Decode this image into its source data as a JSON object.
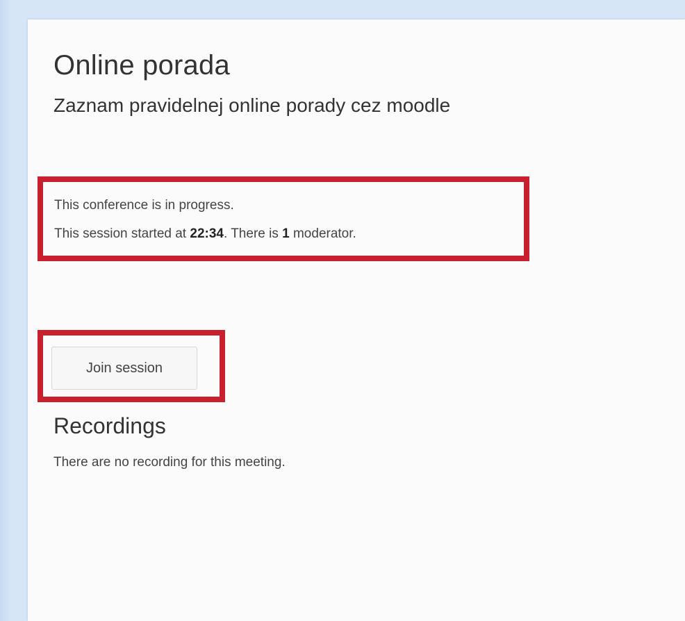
{
  "meeting": {
    "title": "Online porada",
    "description": "Zaznam pravidelnej online porady cez moodle"
  },
  "status": {
    "line1": "This conference is in progress.",
    "line2_prefix": "This session started at ",
    "start_time": "22:34",
    "line2_middle": ". There is ",
    "moderator_count": "1",
    "line2_suffix": " moderator."
  },
  "actions": {
    "join_label": "Join session"
  },
  "recordings": {
    "heading": "Recordings",
    "empty_message": "There are no recording for this meeting."
  },
  "colors": {
    "highlight_border": "#c8202f",
    "page_background": "#d7e6f6",
    "panel_background": "#fbfbfb"
  }
}
